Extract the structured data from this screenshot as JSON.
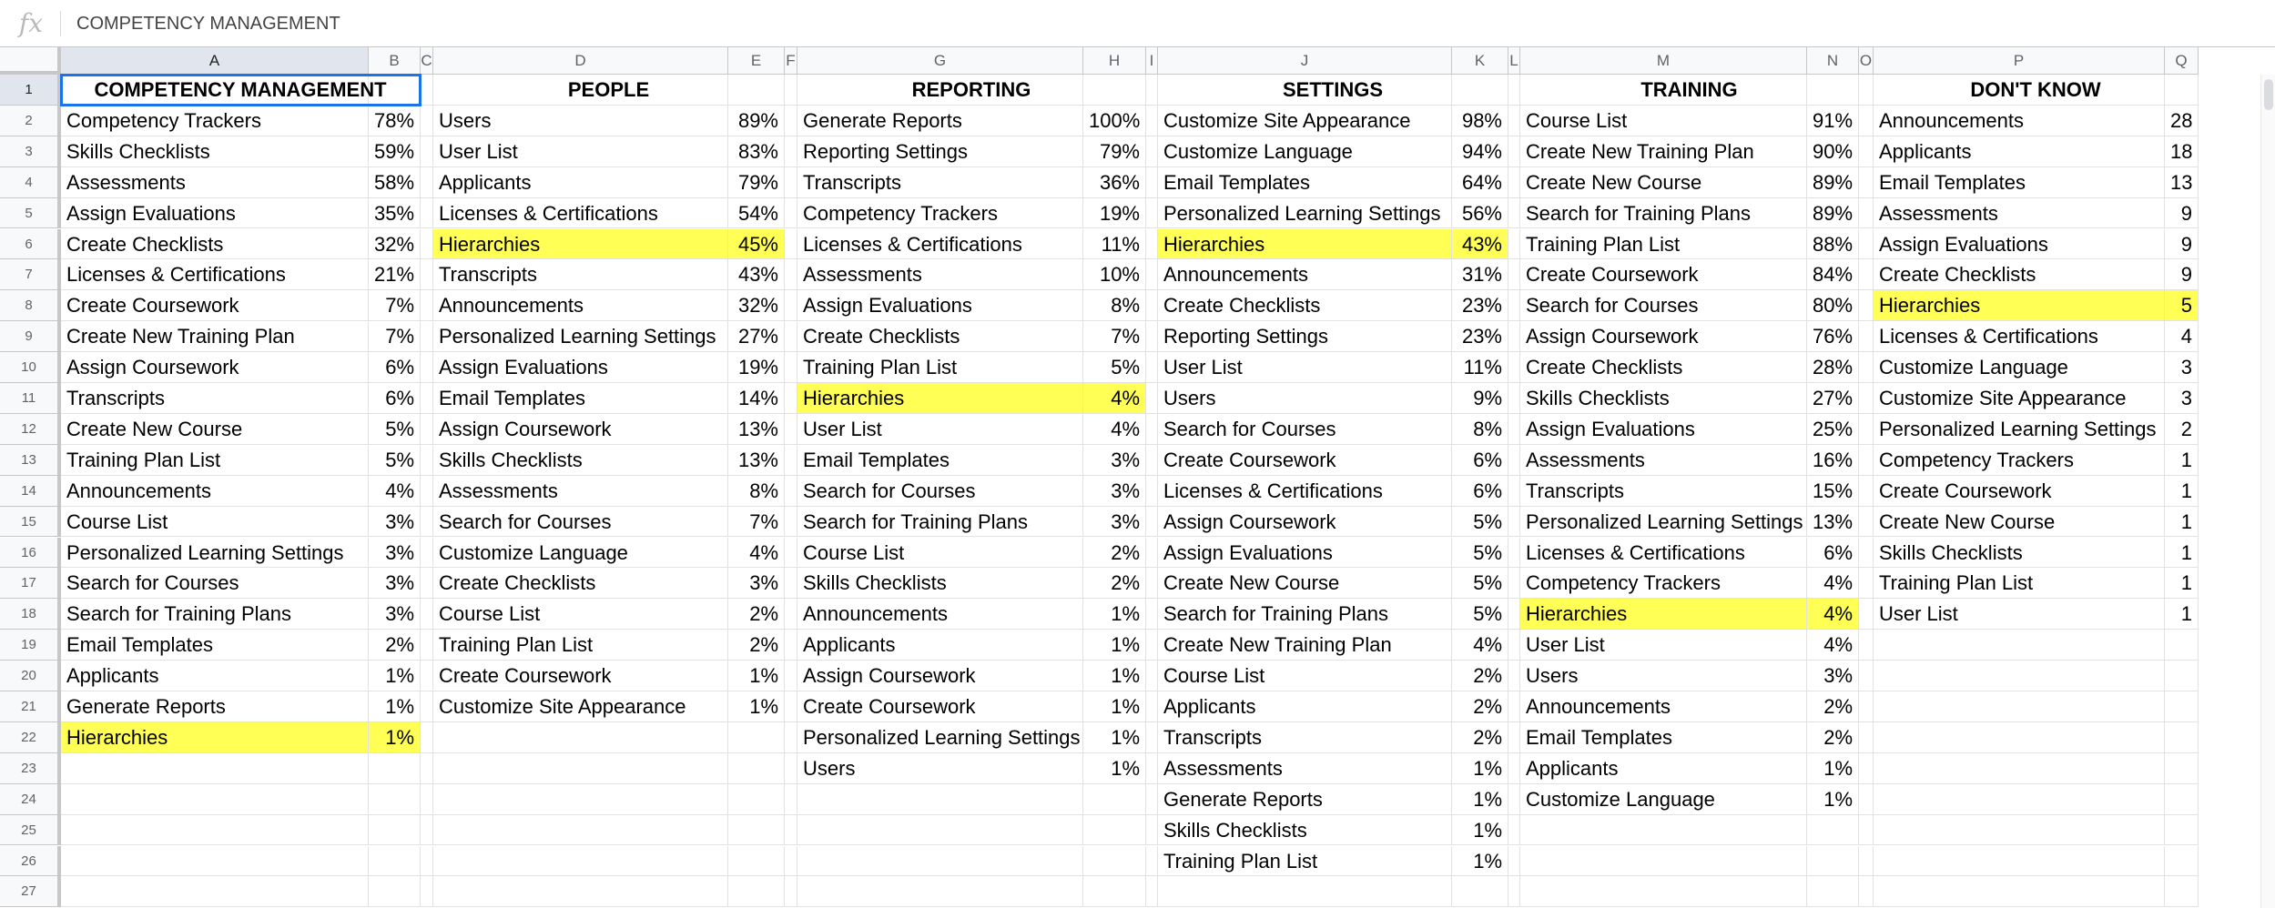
{
  "formula_bar": {
    "fx_label": "fx",
    "content": "COMPETENCY MANAGEMENT"
  },
  "columns": [
    "A",
    "B",
    "C",
    "D",
    "E",
    "F",
    "G",
    "H",
    "I",
    "J",
    "K",
    "L",
    "M",
    "N",
    "O",
    "P",
    "Q"
  ],
  "rows": [
    "1",
    "2",
    "3",
    "4",
    "5",
    "6",
    "7",
    "8",
    "9",
    "10",
    "11",
    "12",
    "13",
    "14",
    "15",
    "16",
    "17",
    "18",
    "19",
    "20",
    "21",
    "22",
    "23",
    "24",
    "25",
    "26",
    "27"
  ],
  "selected_cell": "A1",
  "highlight_color": "#ffff55",
  "sections": [
    {
      "title": "COMPETENCY MANAGEMENT",
      "items": [
        {
          "name": "Competency Trackers",
          "value": "78%"
        },
        {
          "name": "Skills Checklists",
          "value": "59%"
        },
        {
          "name": "Assessments",
          "value": "58%"
        },
        {
          "name": "Assign Evaluations",
          "value": "35%"
        },
        {
          "name": "Create Checklists",
          "value": "32%"
        },
        {
          "name": "Licenses & Certifications",
          "value": "21%"
        },
        {
          "name": "Create Coursework",
          "value": "7%"
        },
        {
          "name": "Create New Training Plan",
          "value": "7%"
        },
        {
          "name": "Assign Coursework",
          "value": "6%"
        },
        {
          "name": "Transcripts",
          "value": "6%"
        },
        {
          "name": "Create New Course",
          "value": "5%"
        },
        {
          "name": "Training Plan List",
          "value": "5%"
        },
        {
          "name": "Announcements",
          "value": "4%"
        },
        {
          "name": "Course List",
          "value": "3%"
        },
        {
          "name": "Personalized Learning Settings",
          "value": "3%"
        },
        {
          "name": "Search for Courses",
          "value": "3%"
        },
        {
          "name": "Search for Training Plans",
          "value": "3%"
        },
        {
          "name": "Email Templates",
          "value": "2%"
        },
        {
          "name": "Applicants",
          "value": "1%"
        },
        {
          "name": "Generate Reports",
          "value": "1%"
        },
        {
          "name": "Hierarchies",
          "value": "1%",
          "highlight": true
        }
      ]
    },
    {
      "title": "PEOPLE",
      "items": [
        {
          "name": "Users",
          "value": "89%"
        },
        {
          "name": "User List",
          "value": "83%"
        },
        {
          "name": "Applicants",
          "value": "79%"
        },
        {
          "name": "Licenses & Certifications",
          "value": "54%"
        },
        {
          "name": "Hierarchies",
          "value": "45%",
          "highlight": true
        },
        {
          "name": "Transcripts",
          "value": "43%"
        },
        {
          "name": "Announcements",
          "value": "32%"
        },
        {
          "name": "Personalized Learning Settings",
          "value": "27%"
        },
        {
          "name": "Assign Evaluations",
          "value": "19%"
        },
        {
          "name": "Email Templates",
          "value": "14%"
        },
        {
          "name": "Assign Coursework",
          "value": "13%"
        },
        {
          "name": "Skills Checklists",
          "value": "13%"
        },
        {
          "name": "Assessments",
          "value": "8%"
        },
        {
          "name": "Search for Courses",
          "value": "7%"
        },
        {
          "name": "Customize Language",
          "value": "4%"
        },
        {
          "name": "Create Checklists",
          "value": "3%"
        },
        {
          "name": "Course List",
          "value": "2%"
        },
        {
          "name": "Training Plan List",
          "value": "2%"
        },
        {
          "name": "Create Coursework",
          "value": "1%"
        },
        {
          "name": "Customize Site Appearance",
          "value": "1%"
        }
      ]
    },
    {
      "title": "REPORTING",
      "items": [
        {
          "name": "Generate Reports",
          "value": "100%"
        },
        {
          "name": "Reporting Settings",
          "value": "79%"
        },
        {
          "name": "Transcripts",
          "value": "36%"
        },
        {
          "name": "Competency Trackers",
          "value": "19%"
        },
        {
          "name": "Licenses & Certifications",
          "value": "11%"
        },
        {
          "name": "Assessments",
          "value": "10%"
        },
        {
          "name": "Assign Evaluations",
          "value": "8%"
        },
        {
          "name": "Create Checklists",
          "value": "7%"
        },
        {
          "name": "Training Plan List",
          "value": "5%"
        },
        {
          "name": "Hierarchies",
          "value": "4%",
          "highlight": true
        },
        {
          "name": "User List",
          "value": "4%"
        },
        {
          "name": "Email Templates",
          "value": "3%"
        },
        {
          "name": "Search for Courses",
          "value": "3%"
        },
        {
          "name": "Search for Training Plans",
          "value": "3%"
        },
        {
          "name": "Course List",
          "value": "2%"
        },
        {
          "name": "Skills Checklists",
          "value": "2%"
        },
        {
          "name": "Announcements",
          "value": "1%"
        },
        {
          "name": "Applicants",
          "value": "1%"
        },
        {
          "name": "Assign Coursework",
          "value": "1%"
        },
        {
          "name": "Create Coursework",
          "value": "1%"
        },
        {
          "name": "Personalized Learning Settings",
          "value": "1%"
        },
        {
          "name": "Users",
          "value": "1%"
        }
      ]
    },
    {
      "title": "SETTINGS",
      "items": [
        {
          "name": "Customize Site Appearance",
          "value": "98%"
        },
        {
          "name": "Customize Language",
          "value": "94%"
        },
        {
          "name": "Email Templates",
          "value": "64%"
        },
        {
          "name": "Personalized Learning Settings",
          "value": "56%"
        },
        {
          "name": "Hierarchies",
          "value": "43%",
          "highlight": true
        },
        {
          "name": "Announcements",
          "value": "31%"
        },
        {
          "name": "Create Checklists",
          "value": "23%"
        },
        {
          "name": "Reporting Settings",
          "value": "23%"
        },
        {
          "name": "User List",
          "value": "11%"
        },
        {
          "name": "Users",
          "value": "9%"
        },
        {
          "name": "Search for Courses",
          "value": "8%"
        },
        {
          "name": "Create Coursework",
          "value": "6%"
        },
        {
          "name": "Licenses & Certifications",
          "value": "6%"
        },
        {
          "name": "Assign Coursework",
          "value": "5%"
        },
        {
          "name": "Assign Evaluations",
          "value": "5%"
        },
        {
          "name": "Create New Course",
          "value": "5%"
        },
        {
          "name": "Search for Training Plans",
          "value": "5%"
        },
        {
          "name": "Create New Training Plan",
          "value": "4%"
        },
        {
          "name": "Course List",
          "value": "2%"
        },
        {
          "name": "Applicants",
          "value": "2%"
        },
        {
          "name": "Transcripts",
          "value": "2%"
        },
        {
          "name": "Assessments",
          "value": "1%"
        },
        {
          "name": "Generate Reports",
          "value": "1%"
        },
        {
          "name": "Skills Checklists",
          "value": "1%"
        },
        {
          "name": "Training Plan List",
          "value": "1%"
        }
      ]
    },
    {
      "title": "TRAINING",
      "items": [
        {
          "name": "Course List",
          "value": "91%"
        },
        {
          "name": "Create New Training Plan",
          "value": "90%"
        },
        {
          "name": "Create New Course",
          "value": "89%"
        },
        {
          "name": "Search for Training Plans",
          "value": "89%"
        },
        {
          "name": "Training Plan List",
          "value": "88%"
        },
        {
          "name": "Create Coursework",
          "value": "84%"
        },
        {
          "name": "Search for Courses",
          "value": "80%"
        },
        {
          "name": "Assign Coursework",
          "value": "76%"
        },
        {
          "name": "Create Checklists",
          "value": "28%"
        },
        {
          "name": "Skills Checklists",
          "value": "27%"
        },
        {
          "name": "Assign Evaluations",
          "value": "25%"
        },
        {
          "name": "Assessments",
          "value": "16%"
        },
        {
          "name": "Transcripts",
          "value": "15%"
        },
        {
          "name": "Personalized Learning Settings",
          "value": "13%"
        },
        {
          "name": "Licenses & Certifications",
          "value": "6%"
        },
        {
          "name": "Competency Trackers",
          "value": "4%"
        },
        {
          "name": "Hierarchies",
          "value": "4%",
          "highlight": true
        },
        {
          "name": "User List",
          "value": "4%"
        },
        {
          "name": "Users",
          "value": "3%"
        },
        {
          "name": "Announcements",
          "value": "2%"
        },
        {
          "name": "Email Templates",
          "value": "2%"
        },
        {
          "name": "Applicants",
          "value": "1%"
        },
        {
          "name": "Customize Language",
          "value": "1%"
        }
      ]
    },
    {
      "title": "DON'T KNOW",
      "items": [
        {
          "name": "Announcements",
          "value": "28"
        },
        {
          "name": "Applicants",
          "value": "18"
        },
        {
          "name": "Email Templates",
          "value": "13"
        },
        {
          "name": "Assessments",
          "value": "9"
        },
        {
          "name": "Assign Evaluations",
          "value": "9"
        },
        {
          "name": "Create Checklists",
          "value": "9"
        },
        {
          "name": "Hierarchies",
          "value": "5",
          "highlight": true
        },
        {
          "name": "Licenses & Certifications",
          "value": "4"
        },
        {
          "name": "Customize Language",
          "value": "3"
        },
        {
          "name": "Customize Site Appearance",
          "value": "3"
        },
        {
          "name": "Personalized Learning Settings",
          "value": "2"
        },
        {
          "name": "Competency Trackers",
          "value": "1"
        },
        {
          "name": "Create Coursework",
          "value": "1"
        },
        {
          "name": "Create New Course",
          "value": "1"
        },
        {
          "name": "Skills Checklists",
          "value": "1"
        },
        {
          "name": "Training Plan List",
          "value": "1"
        },
        {
          "name": "User List",
          "value": "1"
        }
      ]
    }
  ]
}
